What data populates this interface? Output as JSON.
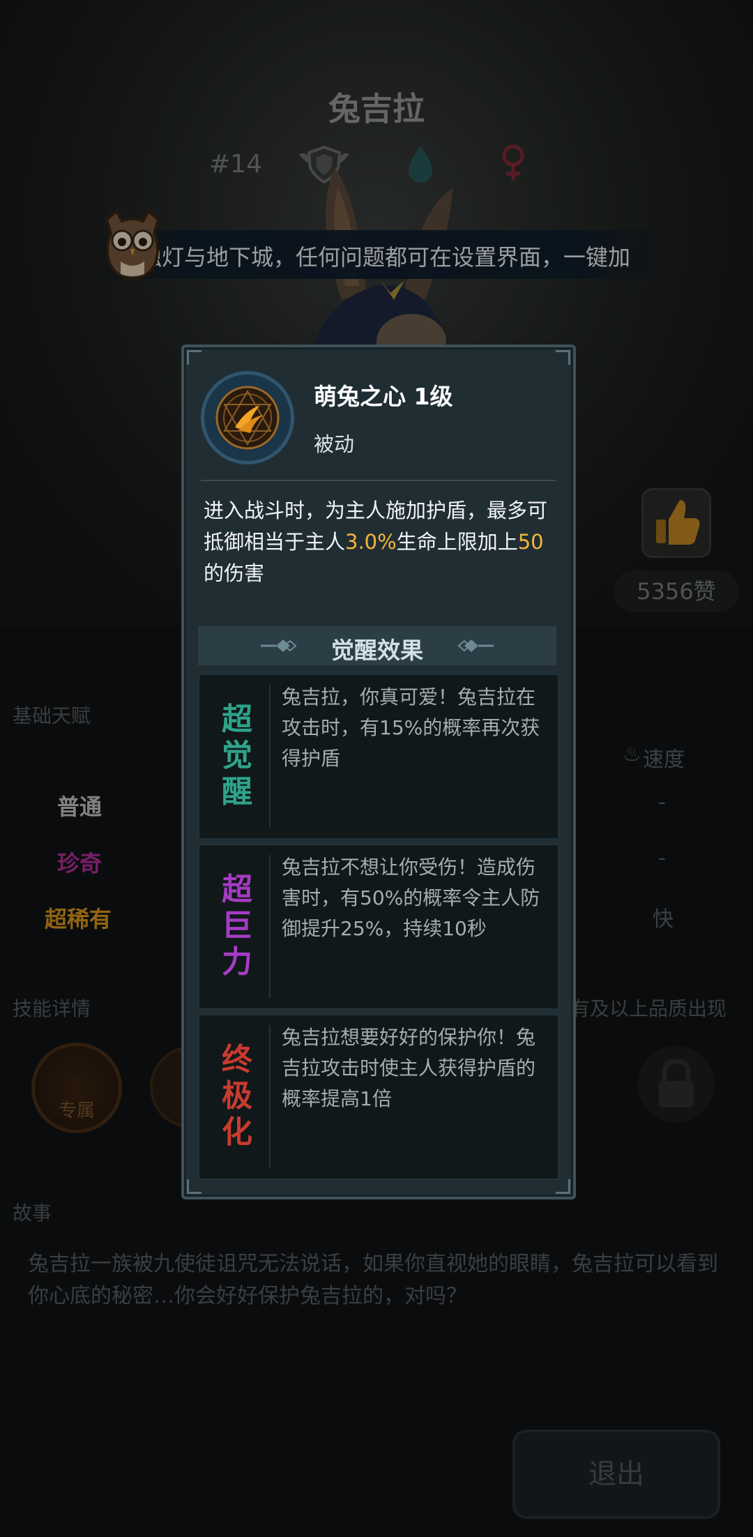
{
  "background": {
    "character_name": "兔吉拉",
    "character_number": "#14",
    "marquee_text": "烛灯与地下城，任何问题都可在设置界面，一键加",
    "like_count": "5356赞",
    "section_basic": "基础天赋",
    "rarities": [
      "普通",
      "珍奇",
      "超稀有"
    ],
    "speed_label": "速度",
    "speed_values": [
      "-",
      "-",
      "快"
    ],
    "section_skill": "技能详情",
    "skill_note": "有及以上品质出现",
    "skill_exclusive_label": "专属",
    "section_story": "故事",
    "story_text": "兔吉拉一族被九使徒诅咒无法说话，如果你直视她的眼睛，兔吉拉可以看到你心底的秘密…你会好好保护兔吉拉的，对吗？",
    "exit_button": "退出"
  },
  "modal": {
    "skill_name": "萌兔之心 1级",
    "skill_type": "被动",
    "description_parts": [
      "进入战斗时，为主人施加护盾，最多可抵御相当于主人",
      "3.0%",
      "生命上限加上",
      "50",
      "的伤害"
    ],
    "awaken_title": "觉醒效果",
    "awaken_effects": [
      {
        "badge": "超觉醒",
        "color": "#2fa38a",
        "text": "兔吉拉，你真可爱！兔吉拉在攻击时，有15%的概率再次获得护盾"
      },
      {
        "badge": "超巨力",
        "color": "#a53cc4",
        "text": "兔吉拉不想让你受伤！造成伤害时，有50%的概率令主人防御提升25%，持续10秒"
      },
      {
        "badge": "终极化",
        "color": "#c93b2e",
        "text": "兔吉拉想要好好的保护你！兔吉拉攻击时使主人获得护盾的概率提高1倍"
      }
    ]
  },
  "colors": {
    "highlight": "#f5b53a",
    "rarity_common": "#c7cac8",
    "rarity_rare": "#b5309f",
    "rarity_super": "#e09a1e"
  }
}
